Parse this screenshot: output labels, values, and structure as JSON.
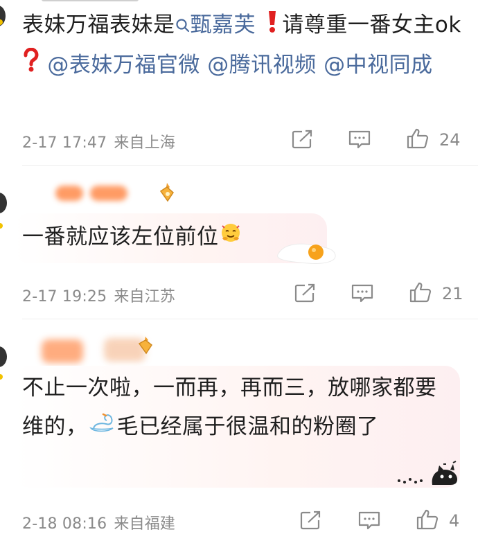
{
  "comments": [
    {
      "text_main": "表妹万福表妹是",
      "search_term": "甄嘉芙",
      "text_after_search": "请尊重一番女主ok",
      "mentions": [
        "@表妹万福官微",
        "@腾讯视频",
        "@中视同成"
      ],
      "date": "2-17 17:47",
      "location": "来自上海",
      "likes": "24"
    },
    {
      "text": "一番就应该左位前位",
      "date": "2-17 19:25",
      "location": "来自江苏",
      "likes": "21"
    },
    {
      "text_part1": "不止一次啦，一而再，再而三，放哪家都要维的，",
      "text_part2": "毛已经属于很温和的粉圈了",
      "date": "2-18 08:16",
      "location": "来自福建",
      "likes": "4"
    }
  ],
  "colors": {
    "link": "#4a6a9c",
    "meta": "#8a8a8a",
    "bubble_tint": "#fdeff1",
    "warning_red": "#e02020"
  },
  "icons": [
    "search-icon",
    "exclamation-icon",
    "question-icon",
    "share-icon",
    "comment-icon",
    "like-icon",
    "hug-emoji-icon",
    "egg-icon",
    "swan-emoji-icon",
    "cat-sticker-icon",
    "badge-icon"
  ]
}
